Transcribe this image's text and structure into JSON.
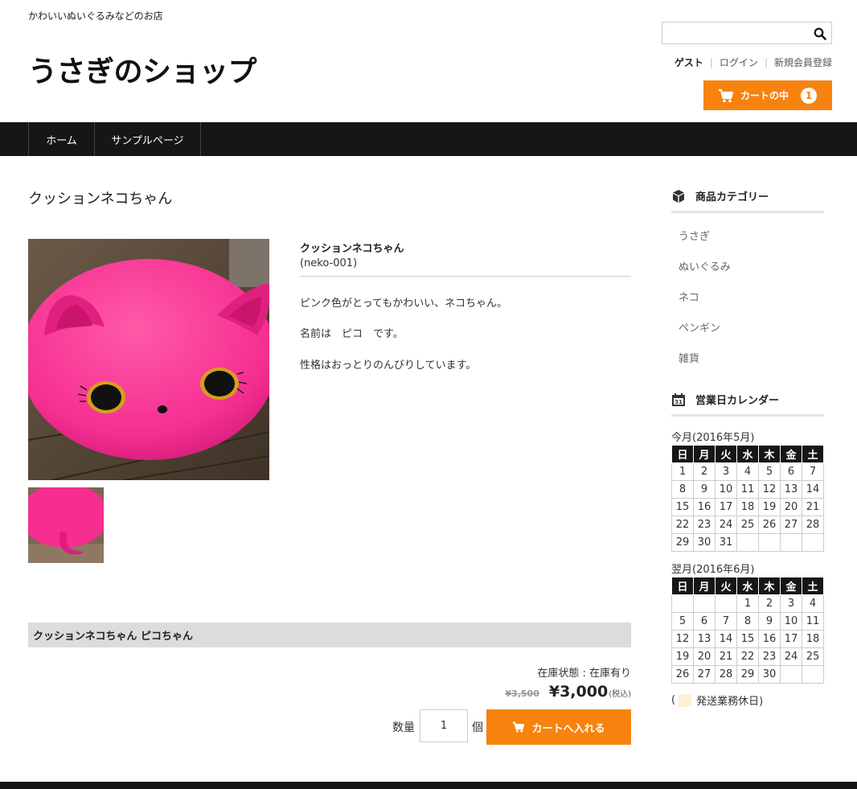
{
  "header": {
    "tagline": "かわいいぬいぐるみなどのお店",
    "site_title": "うさぎのショップ",
    "search_placeholder": "",
    "user": {
      "guest": "ゲスト",
      "login": "ログイン",
      "register": "新規会員登録"
    },
    "cart": {
      "label": "カートの中",
      "count": "1"
    }
  },
  "nav": {
    "home": "ホーム",
    "sample": "サンプルページ"
  },
  "product": {
    "page_title": "クッションネコちゃん",
    "name": "クッションネコちゃん",
    "code": "(neko-001)",
    "description": [
      "ピンク色がとってもかわいい、ネコちゃん。",
      "名前は　ピコ　です。",
      "性格はおっとりのんびりしています。"
    ],
    "variant_name": "クッションネコちゃん ピコちゃん",
    "stock": "在庫状態 : 在庫有り",
    "price_old": "¥3,500",
    "price": "¥3,000",
    "tax_note": "(税込)",
    "qty_label": "数量",
    "qty_value": "1",
    "qty_unit": "個",
    "add_to_cart": "カートへ入れる"
  },
  "sidebar": {
    "categories_title": "商品カテゴリー",
    "categories": [
      "うさぎ",
      "ぬいぐるみ",
      "ネコ",
      "ペンギン",
      "雑貨"
    ],
    "calendar_title": "営業日カレンダー",
    "weekdays": [
      "日",
      "月",
      "火",
      "水",
      "木",
      "金",
      "土"
    ],
    "this_month_label": "今月(2016年5月)",
    "this_month": [
      [
        "1",
        "2",
        "3",
        "4",
        "5",
        "6",
        "7"
      ],
      [
        "8",
        "9",
        "10",
        "11",
        "12",
        "13",
        "14"
      ],
      [
        "15",
        "16",
        "17",
        "18",
        "19",
        "20",
        "21"
      ],
      [
        "22",
        "23",
        "24",
        "25",
        "26",
        "27",
        "28"
      ],
      [
        "29",
        "30",
        "31",
        "",
        "",
        "",
        ""
      ]
    ],
    "next_month_label": "翌月(2016年6月)",
    "next_month": [
      [
        "",
        "",
        "",
        "1",
        "2",
        "3",
        "4"
      ],
      [
        "5",
        "6",
        "7",
        "8",
        "9",
        "10",
        "11"
      ],
      [
        "12",
        "13",
        "14",
        "15",
        "16",
        "17",
        "18"
      ],
      [
        "19",
        "20",
        "21",
        "22",
        "23",
        "24",
        "25"
      ],
      [
        "26",
        "27",
        "28",
        "29",
        "30",
        "",
        ""
      ]
    ],
    "legend_open": "(",
    "legend_text": "発送業務休日)",
    "holiday_color": "#ffefd5"
  },
  "colors": {
    "accent": "#f7830e",
    "nav_bg": "#161616"
  }
}
